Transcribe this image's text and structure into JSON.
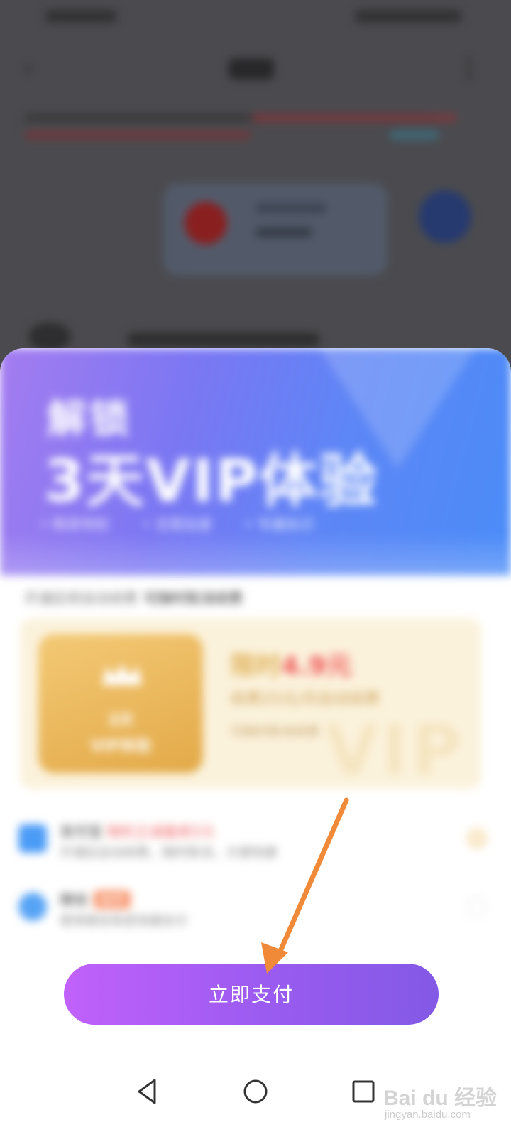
{
  "background": {
    "blurred": true
  },
  "sheet": {
    "hero": {
      "line1": "解锁",
      "line2": "3天VIP体验",
      "perks": [
        "• 畅享特权",
        "• 无限加速",
        "• 专属标识"
      ]
    },
    "tip": {
      "prefix": "开通后将自动续费",
      "strong": "可随时取消续费"
    },
    "offer": {
      "badge_line1": "3天",
      "badge_line2": "VIP体验",
      "title_prefix": "限时",
      "price": "4.9元",
      "subtitle": "续费25元/月自动续费",
      "note": "可随时取消续费",
      "watermark": "VIP"
    },
    "payment_methods": [
      {
        "name": "支付宝",
        "promo": "随机立减最高5元",
        "tag": "",
        "desc": "开通后自动续费，随时取消，方便快捷",
        "selected": true
      },
      {
        "name": "微信",
        "promo": "",
        "tag": "推荐",
        "desc": "使用微信免密快捷支付",
        "selected": false
      }
    ],
    "pay_button_label": "立即支付"
  },
  "navbar": {
    "icons": [
      "back-icon",
      "home-icon",
      "recent-apps-icon"
    ]
  },
  "watermark": {
    "brand": "Bai du 经验",
    "site": "jingyan.baidu.com"
  },
  "colors": {
    "hero_start": "#a47cf0",
    "hero_end": "#4a8cf8",
    "pay_button_start": "#c161fb",
    "pay_button_end": "#8359e5",
    "offer_bg": "#fbf2dc",
    "price_red": "#f05656",
    "annotation_arrow": "#f08a38"
  }
}
